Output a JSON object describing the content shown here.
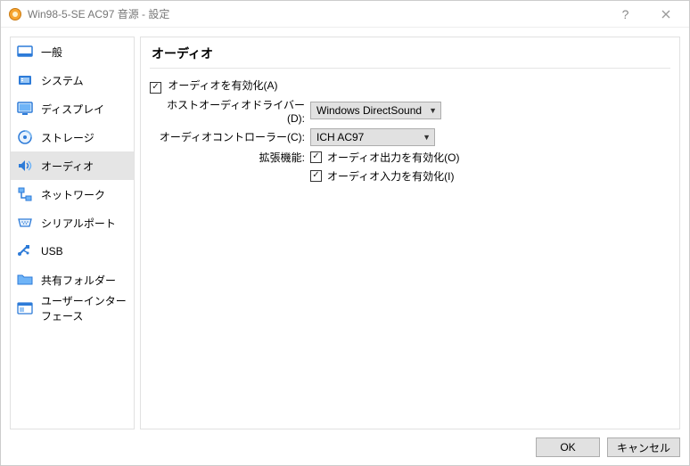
{
  "window": {
    "title": "Win98-5-SE AC97 音源 - 設定"
  },
  "sidebar": {
    "items": [
      {
        "label": "一般"
      },
      {
        "label": "システム"
      },
      {
        "label": "ディスプレイ"
      },
      {
        "label": "ストレージ"
      },
      {
        "label": "オーディオ"
      },
      {
        "label": "ネットワーク"
      },
      {
        "label": "シリアルポート"
      },
      {
        "label": "USB"
      },
      {
        "label": "共有フォルダー"
      },
      {
        "label": "ユーザーインターフェース"
      }
    ]
  },
  "main": {
    "heading": "オーディオ",
    "enable_audio_label": "オーディオを有効化(A)",
    "host_driver_label": "ホストオーディオドライバー(D):",
    "host_driver_value": "Windows DirectSound",
    "controller_label": "オーディオコントローラー(C):",
    "controller_value": "ICH AC97",
    "ext_label": "拡張機能:",
    "out_enable_label": "オーディオ出力を有効化(O)",
    "in_enable_label": "オーディオ入力を有効化(I)"
  },
  "footer": {
    "ok": "OK",
    "cancel": "キャンセル"
  }
}
